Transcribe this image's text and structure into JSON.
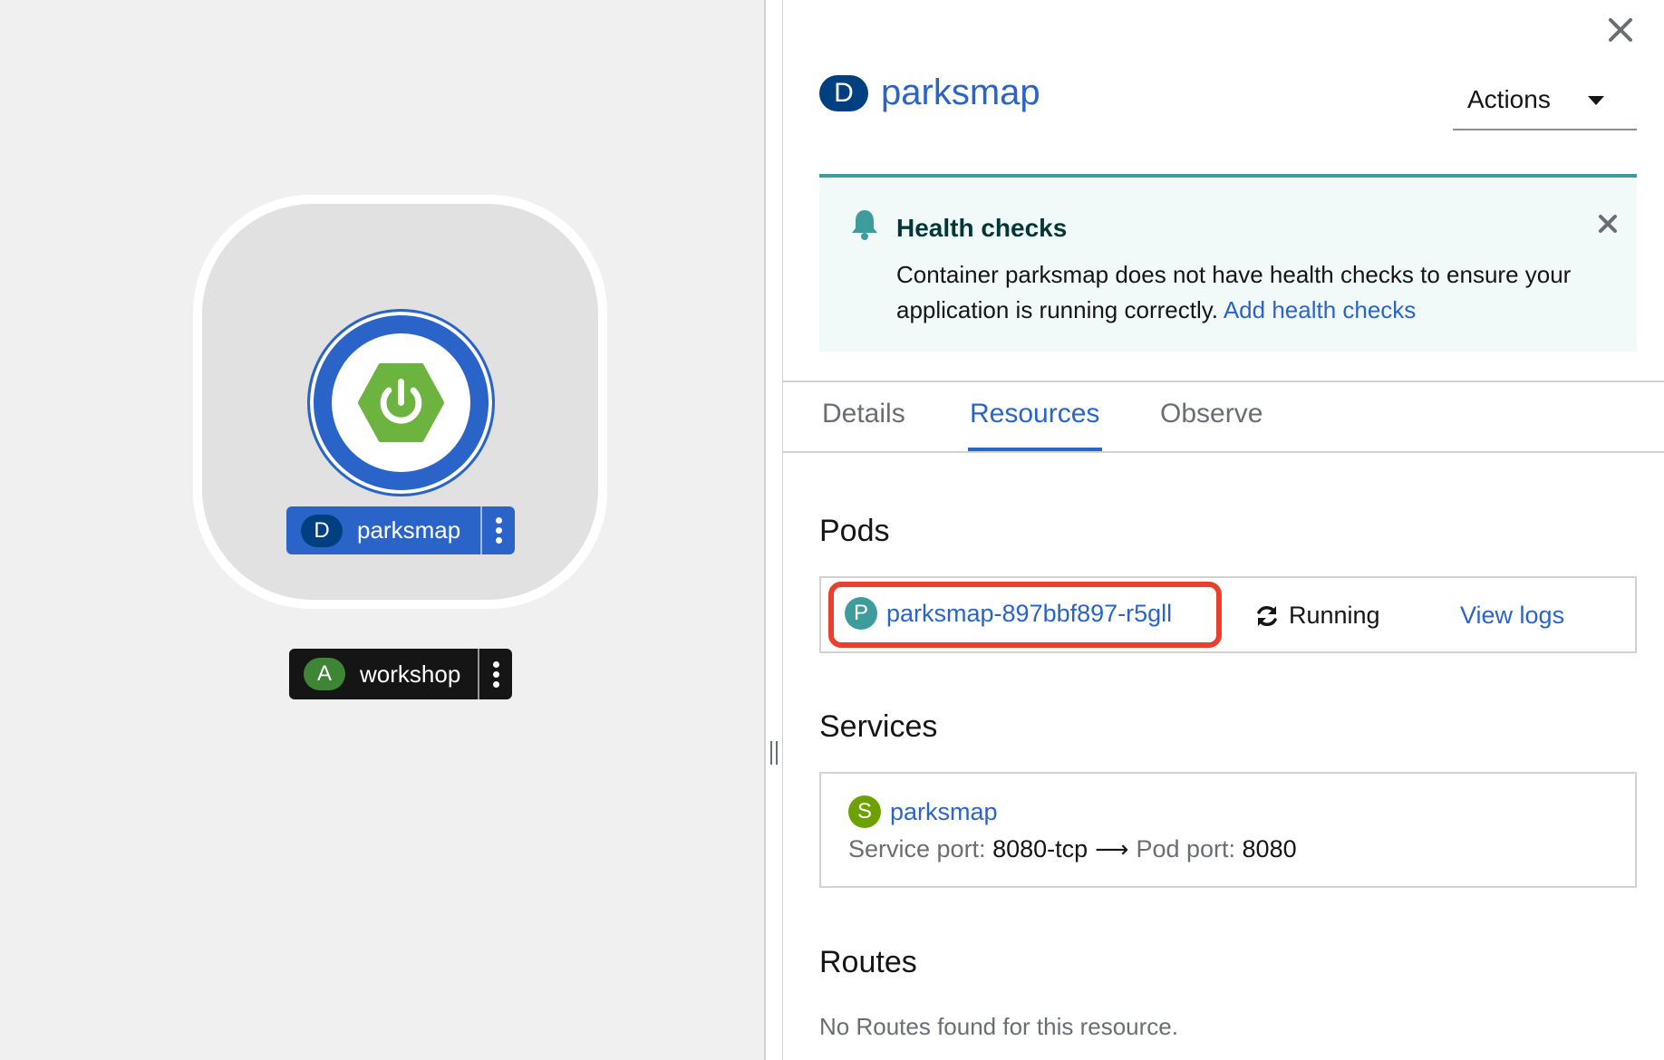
{
  "topology": {
    "deployment_node": {
      "badge": "D",
      "name": "parksmap",
      "icon": "power-hexagon-icon"
    },
    "application_group": {
      "badge": "A",
      "name": "workshop"
    }
  },
  "panel": {
    "title_badge": "D",
    "title": "parksmap",
    "actions_label": "Actions",
    "alert": {
      "title": "Health checks",
      "body": "Container parksmap does not have health checks to ensure your application is running correctly.",
      "link": "Add health checks"
    },
    "tabs": [
      {
        "label": "Details",
        "active": false
      },
      {
        "label": "Resources",
        "active": true
      },
      {
        "label": "Observe",
        "active": false
      }
    ],
    "pods": {
      "heading": "Pods",
      "items": [
        {
          "badge": "P",
          "name": "parksmap-897bbf897-r5gll",
          "status": "Running",
          "logs_link": "View logs"
        }
      ]
    },
    "services": {
      "heading": "Services",
      "items": [
        {
          "badge": "S",
          "name": "parksmap",
          "service_port_label": "Service port:",
          "service_port": "8080-tcp",
          "pod_port_label": "Pod port:",
          "pod_port": "8080"
        }
      ]
    },
    "routes": {
      "heading": "Routes",
      "empty_message": "No Routes found for this resource."
    }
  },
  "colors": {
    "accent_blue": "#2b64c8",
    "deployment_badge": "#004080",
    "pod_badge": "#3f9c9d",
    "service_badge": "#6ca100",
    "app_badge": "#3e8635",
    "highlight_red": "#e8402d",
    "alert_teal": "#3f9c9d"
  }
}
